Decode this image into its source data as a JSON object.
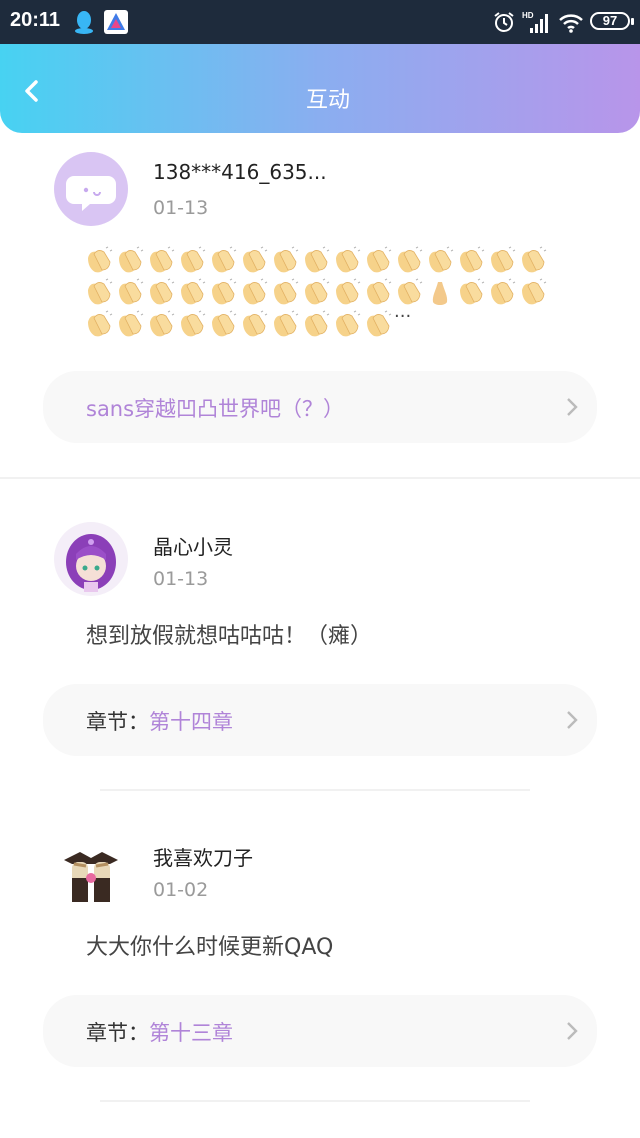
{
  "status_bar": {
    "time": "20:11",
    "battery": "97",
    "icons": [
      "qq-icon",
      "app-icon",
      "alarm-icon",
      "hd-signal-icon",
      "wifi-icon",
      "battery-icon"
    ]
  },
  "header": {
    "title": "互动",
    "back_icon": "chevron-left-icon",
    "gradient": [
      "#47d2f2",
      "#b895ea"
    ]
  },
  "comments": [
    {
      "username": "138***416_635...",
      "date": "01-13",
      "content_ellipsis": "···",
      "link_text": "sans穿越凹凸世界吧（？）",
      "avatar_icon": "chat-bubble-avatar-icon"
    },
    {
      "username": "晶心小灵",
      "date": "01-13",
      "content": "想到放假就想咕咕咕！（瘫）",
      "link_prefix": "章节：",
      "link_text": "第十四章"
    },
    {
      "username": "我喜欢刀子",
      "date": "01-02",
      "content": "大大你什么时候更新QAQ",
      "link_prefix": "章节：",
      "link_text": "第十三章"
    }
  ],
  "colors": {
    "accent": "#b084d8",
    "status_bar": "#1e2b3c"
  }
}
